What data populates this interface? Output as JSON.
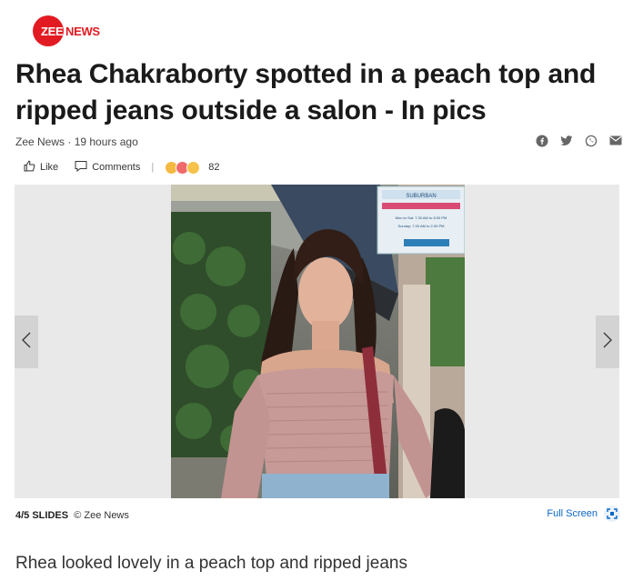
{
  "brand": {
    "zee": "ZEE",
    "news": "NEWS"
  },
  "article": {
    "title": "Rhea Chakraborty spotted in a peach top and ripped jeans outside a salon - In pics",
    "source": "Zee News",
    "time": "19 hours ago"
  },
  "actions": {
    "like": "Like",
    "comments": "Comments",
    "reaction_count": "82"
  },
  "share_icons": [
    "facebook-icon",
    "twitter-icon",
    "whatsapp-icon",
    "mail-icon"
  ],
  "slideshow": {
    "counter": "4/5 SLIDES",
    "credit": "© Zee News",
    "fullscreen_label": "Full Screen",
    "description": "Rhea looked lovely in a peach top and ripped jeans",
    "sign_lines": [
      "SUBURBAN",
      "Mon to Sat: 7.30 AM to 8.00 PM",
      "Sunday: 7.00 AM to 2.00 PM"
    ]
  },
  "colors": {
    "brand_red": "#e21b22",
    "link_blue": "#0a66c2"
  }
}
